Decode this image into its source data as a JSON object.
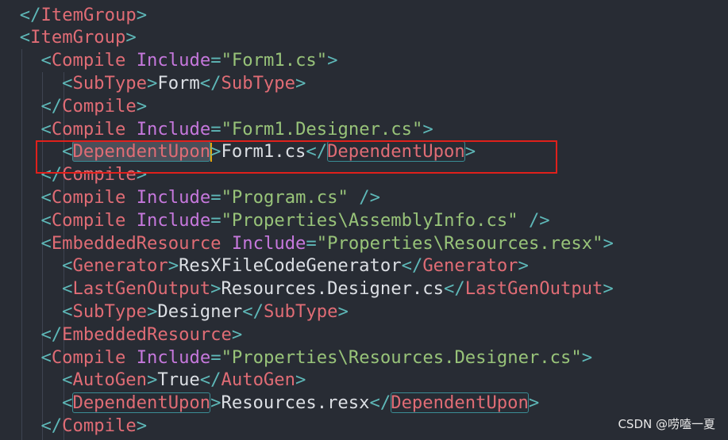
{
  "colors": {
    "background": "#282c34",
    "punctuation": "#5eb8b8",
    "tag": "#e06c75",
    "attribute": "#c678dd",
    "string": "#98c379",
    "text": "#dcdfe4",
    "annotation_box": "#e0201b",
    "caret": "#e5a50a"
  },
  "code_lines": [
    {
      "indent": 1,
      "tokens": [
        {
          "t": "</",
          "c": "punct"
        },
        {
          "t": "ItemGroup",
          "c": "tag"
        },
        {
          "t": ">",
          "c": "punct"
        }
      ]
    },
    {
      "indent": 1,
      "tokens": [
        {
          "t": "<",
          "c": "punct"
        },
        {
          "t": "ItemGroup",
          "c": "tag"
        },
        {
          "t": ">",
          "c": "punct"
        }
      ]
    },
    {
      "indent": 2,
      "tokens": [
        {
          "t": "<",
          "c": "punct"
        },
        {
          "t": "Compile",
          "c": "tag"
        },
        {
          "t": " ",
          "c": "text"
        },
        {
          "t": "Include",
          "c": "attr"
        },
        {
          "t": "=",
          "c": "punct"
        },
        {
          "t": "\"Form1.cs\"",
          "c": "str"
        },
        {
          "t": ">",
          "c": "punct"
        }
      ]
    },
    {
      "indent": 3,
      "tokens": [
        {
          "t": "<",
          "c": "punct"
        },
        {
          "t": "SubType",
          "c": "tag"
        },
        {
          "t": ">",
          "c": "punct"
        },
        {
          "t": "Form",
          "c": "text"
        },
        {
          "t": "</",
          "c": "punct"
        },
        {
          "t": "SubType",
          "c": "tag"
        },
        {
          "t": ">",
          "c": "punct"
        }
      ]
    },
    {
      "indent": 2,
      "tokens": [
        {
          "t": "</",
          "c": "punct"
        },
        {
          "t": "Compile",
          "c": "tag"
        },
        {
          "t": ">",
          "c": "punct"
        }
      ]
    },
    {
      "indent": 2,
      "tokens": [
        {
          "t": "<",
          "c": "punct"
        },
        {
          "t": "Compile",
          "c": "tag"
        },
        {
          "t": " ",
          "c": "text"
        },
        {
          "t": "Include",
          "c": "attr"
        },
        {
          "t": "=",
          "c": "punct"
        },
        {
          "t": "\"Form1.Designer.cs\"",
          "c": "str"
        },
        {
          "t": ">",
          "c": "punct"
        }
      ]
    },
    {
      "indent": 3,
      "caret_after": 1,
      "tokens": [
        {
          "t": "<",
          "c": "punct"
        },
        {
          "t": "DependentUpon",
          "c": "tag",
          "hl": true,
          "sel": true
        },
        {
          "t": ">",
          "c": "punct"
        },
        {
          "t": "Form1.cs",
          "c": "text"
        },
        {
          "t": "</",
          "c": "punct"
        },
        {
          "t": "DependentUpon",
          "c": "tag",
          "hl": true
        },
        {
          "t": ">",
          "c": "punct"
        }
      ]
    },
    {
      "indent": 2,
      "tokens": [
        {
          "t": "</",
          "c": "punct"
        },
        {
          "t": "Compile",
          "c": "tag"
        },
        {
          "t": ">",
          "c": "punct"
        }
      ]
    },
    {
      "indent": 2,
      "tokens": [
        {
          "t": "<",
          "c": "punct"
        },
        {
          "t": "Compile",
          "c": "tag"
        },
        {
          "t": " ",
          "c": "text"
        },
        {
          "t": "Include",
          "c": "attr"
        },
        {
          "t": "=",
          "c": "punct"
        },
        {
          "t": "\"Program.cs\"",
          "c": "str"
        },
        {
          "t": " />",
          "c": "punct"
        }
      ]
    },
    {
      "indent": 2,
      "tokens": [
        {
          "t": "<",
          "c": "punct"
        },
        {
          "t": "Compile",
          "c": "tag"
        },
        {
          "t": " ",
          "c": "text"
        },
        {
          "t": "Include",
          "c": "attr"
        },
        {
          "t": "=",
          "c": "punct"
        },
        {
          "t": "\"Properties\\AssemblyInfo.cs\"",
          "c": "str"
        },
        {
          "t": " />",
          "c": "punct"
        }
      ]
    },
    {
      "indent": 2,
      "tokens": [
        {
          "t": "<",
          "c": "punct"
        },
        {
          "t": "EmbeddedResource",
          "c": "tag"
        },
        {
          "t": " ",
          "c": "text"
        },
        {
          "t": "Include",
          "c": "attr"
        },
        {
          "t": "=",
          "c": "punct"
        },
        {
          "t": "\"Properties\\Resources.resx\"",
          "c": "str"
        },
        {
          "t": ">",
          "c": "punct"
        }
      ]
    },
    {
      "indent": 3,
      "tokens": [
        {
          "t": "<",
          "c": "punct"
        },
        {
          "t": "Generator",
          "c": "tag"
        },
        {
          "t": ">",
          "c": "punct"
        },
        {
          "t": "ResXFileCodeGenerator",
          "c": "text"
        },
        {
          "t": "</",
          "c": "punct"
        },
        {
          "t": "Generator",
          "c": "tag"
        },
        {
          "t": ">",
          "c": "punct"
        }
      ]
    },
    {
      "indent": 3,
      "tokens": [
        {
          "t": "<",
          "c": "punct"
        },
        {
          "t": "LastGenOutput",
          "c": "tag"
        },
        {
          "t": ">",
          "c": "punct"
        },
        {
          "t": "Resources.Designer.cs",
          "c": "text"
        },
        {
          "t": "</",
          "c": "punct"
        },
        {
          "t": "LastGenOutput",
          "c": "tag"
        },
        {
          "t": ">",
          "c": "punct"
        }
      ]
    },
    {
      "indent": 3,
      "tokens": [
        {
          "t": "<",
          "c": "punct"
        },
        {
          "t": "SubType",
          "c": "tag"
        },
        {
          "t": ">",
          "c": "punct"
        },
        {
          "t": "Designer",
          "c": "text"
        },
        {
          "t": "</",
          "c": "punct"
        },
        {
          "t": "SubType",
          "c": "tag"
        },
        {
          "t": ">",
          "c": "punct"
        }
      ]
    },
    {
      "indent": 2,
      "tokens": [
        {
          "t": "</",
          "c": "punct"
        },
        {
          "t": "EmbeddedResource",
          "c": "tag"
        },
        {
          "t": ">",
          "c": "punct"
        }
      ]
    },
    {
      "indent": 2,
      "tokens": [
        {
          "t": "<",
          "c": "punct"
        },
        {
          "t": "Compile",
          "c": "tag"
        },
        {
          "t": " ",
          "c": "text"
        },
        {
          "t": "Include",
          "c": "attr"
        },
        {
          "t": "=",
          "c": "punct"
        },
        {
          "t": "\"Properties\\Resources.Designer.cs\"",
          "c": "str"
        },
        {
          "t": ">",
          "c": "punct"
        }
      ]
    },
    {
      "indent": 3,
      "tokens": [
        {
          "t": "<",
          "c": "punct"
        },
        {
          "t": "AutoGen",
          "c": "tag"
        },
        {
          "t": ">",
          "c": "punct"
        },
        {
          "t": "True",
          "c": "text"
        },
        {
          "t": "</",
          "c": "punct"
        },
        {
          "t": "AutoGen",
          "c": "tag"
        },
        {
          "t": ">",
          "c": "punct"
        }
      ]
    },
    {
      "indent": 3,
      "tokens": [
        {
          "t": "<",
          "c": "punct"
        },
        {
          "t": "DependentUpon",
          "c": "tag",
          "hl": true
        },
        {
          "t": ">",
          "c": "punct"
        },
        {
          "t": "Resources.resx",
          "c": "text"
        },
        {
          "t": "</",
          "c": "punct"
        },
        {
          "t": "DependentUpon",
          "c": "tag",
          "hl": true
        },
        {
          "t": ">",
          "c": "punct"
        }
      ]
    },
    {
      "indent": 2,
      "tokens": [
        {
          "t": "</",
          "c": "punct"
        },
        {
          "t": "Compile",
          "c": "tag"
        },
        {
          "t": ">",
          "c": "punct"
        }
      ]
    }
  ],
  "watermark": "CSDN @唠嗑一夏"
}
